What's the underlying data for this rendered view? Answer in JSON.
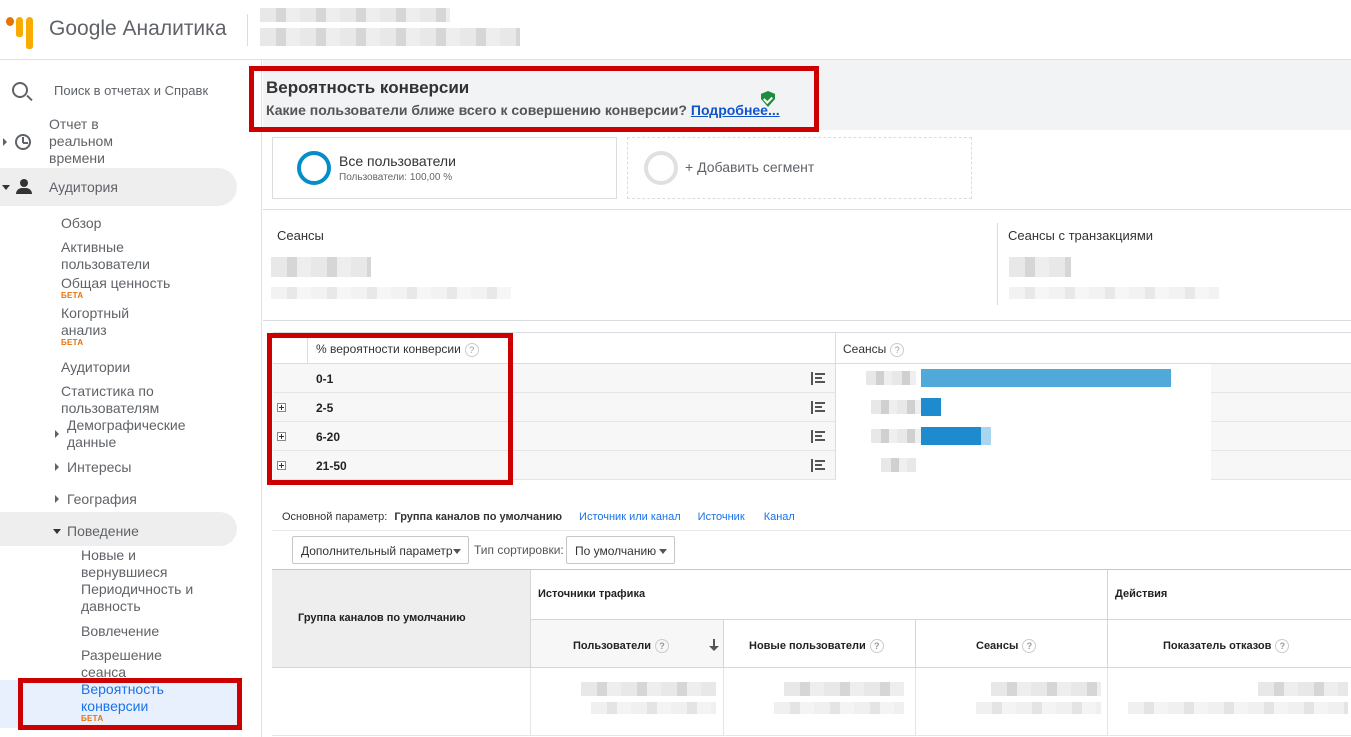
{
  "app": {
    "brand": "Google Аналитика"
  },
  "search": {
    "placeholder": "Поиск в отчетах и Справк"
  },
  "nav": {
    "realtime": "Отчет в реальном времени",
    "audience": "Аудитория",
    "audience_items": {
      "overview": "Обзор",
      "active_users": "Активные пользователи",
      "ltv": "Общая ценность",
      "cohort": "Когортный анализ",
      "audiences": "Аудитории",
      "user_explorer": "Статистика по пользователям",
      "demographics": "Демографические данные",
      "interests": "Интересы",
      "geo": "География",
      "behavior": "Поведение",
      "behavior_items": {
        "new_returning": "Новые и вернувшиеся",
        "frequency": "Периодичность и давность",
        "engagement": "Вовлечение",
        "session_quality": "Разрешение сеанса",
        "conversion_prob": "Вероятность конверсии"
      }
    },
    "beta_label": "БЕТА"
  },
  "page": {
    "title": "Вероятность конверсии",
    "subtitle": "Какие пользователи ближе всего к совершению конверсии?",
    "more_link": "Подробнее..."
  },
  "segments": {
    "all_users_title": "Все пользователи",
    "all_users_sub": "Пользователи: 100,00 %",
    "add_segment": "+ Добавить сегмент"
  },
  "metrics": {
    "sessions_label": "Сеансы",
    "transactions_label": "Сеансы с транзакциями"
  },
  "prob_table": {
    "col_prob": "% вероятности конверсии",
    "col_sessions": "Сеансы",
    "q": "?",
    "rows": [
      {
        "label": "0-1"
      },
      {
        "label": "2-5"
      },
      {
        "label": "6-20"
      },
      {
        "label": "21-50"
      }
    ]
  },
  "dimensions": {
    "primary_label": "Основной параметр:",
    "primary_value": "Группа каналов по умолчанию",
    "links": [
      "Источник или канал",
      "Источник",
      "Канал"
    ]
  },
  "controls": {
    "secondary_dim": "Дополнительный параметр",
    "sort_label": "Тип сортировки:",
    "sort_value": "По умолчанию"
  },
  "data_table": {
    "group_header": "Группа каналов по умолчанию",
    "traffic_header": "Источники трафика",
    "actions_header": "Действия",
    "columns": [
      "Пользователи",
      "Новые пользователи",
      "Сеансы",
      "Показатель отказов"
    ]
  },
  "colors": {
    "accent": "#058dc7",
    "bar": "#50a9d9",
    "highlight_box": "#cc0000",
    "beta": "#e8710a"
  }
}
